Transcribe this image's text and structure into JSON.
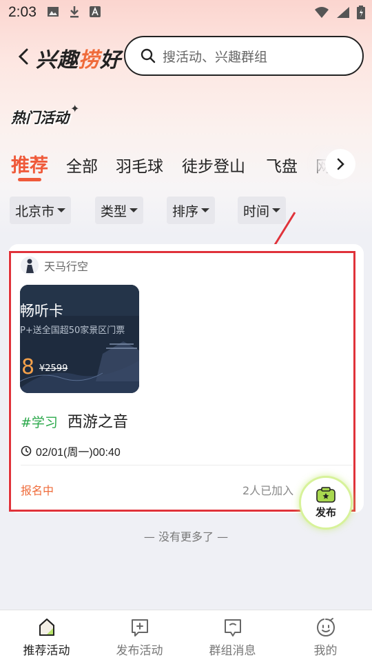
{
  "status_bar": {
    "time": "2:03"
  },
  "header": {
    "logo_main": "兴趣",
    "logo_accent": "捞",
    "logo_tail": "好",
    "search_placeholder": "搜活动、兴趣群组"
  },
  "section": {
    "title": "热门活动"
  },
  "tabs": [
    {
      "label": "推荐",
      "active": true
    },
    {
      "label": "全部"
    },
    {
      "label": "羽毛球"
    },
    {
      "label": "徒步登山"
    },
    {
      "label": "飞盘"
    },
    {
      "label": "网"
    }
  ],
  "filters": [
    {
      "label": "北京市"
    },
    {
      "label": "类型"
    },
    {
      "label": "排序"
    },
    {
      "label": "时间"
    }
  ],
  "activity": {
    "author": "天马行空",
    "cover": {
      "title": "畅听卡",
      "subtitle": "P+送全国超50家景区门票",
      "price": "8",
      "original_price": "¥2599"
    },
    "tag": "#学习",
    "title": "西游之音",
    "time": "02/01(周一)00:40",
    "status": "报名中",
    "joined": "2人已加入"
  },
  "fab": {
    "label": "发布"
  },
  "footer": {
    "no_more": "— 没有更多了 —"
  },
  "bottom_nav": [
    {
      "label": "推荐活动",
      "icon": "home-icon",
      "active": true
    },
    {
      "label": "发布活动",
      "icon": "add-square-icon"
    },
    {
      "label": "群组消息",
      "icon": "chat-icon"
    },
    {
      "label": "我的",
      "icon": "smiley-icon"
    }
  ],
  "colors": {
    "accent": "#ef5a3a",
    "tag_green": "#2aa84a",
    "highlight_red": "#e0323a"
  }
}
